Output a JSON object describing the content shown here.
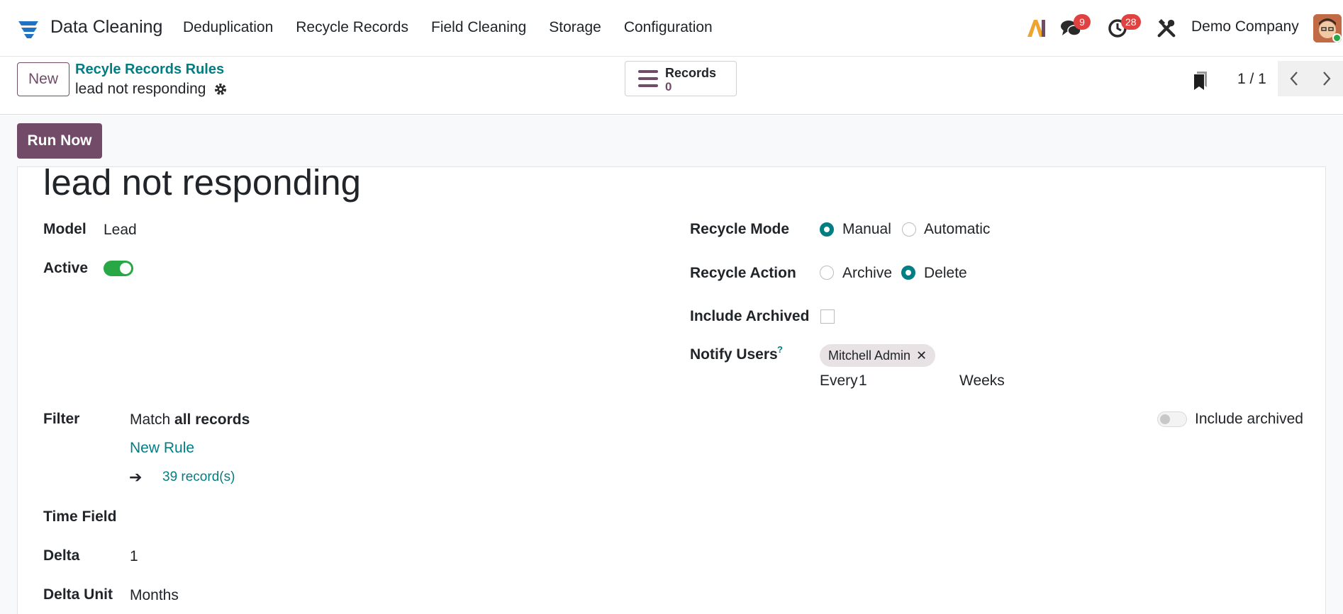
{
  "navbar": {
    "app_name": "Data Cleaning",
    "menu": [
      "Deduplication",
      "Recycle Records",
      "Field Cleaning",
      "Storage",
      "Configuration"
    ],
    "messages_count": "9",
    "activities_count": "28",
    "company": "Demo Company",
    "icons": [
      "app-logo-icon",
      "ai-icon",
      "chat-icon",
      "clock-icon",
      "tools-icon",
      "avatar"
    ]
  },
  "control": {
    "new_label": "New",
    "breadcrumb": "Recyle Records Rules",
    "record_name": "lead not responding",
    "smart_button": {
      "label": "Records",
      "count": "0"
    },
    "pager": "1 / 1"
  },
  "statusbar": {
    "run_now_label": "Run Now"
  },
  "form": {
    "title": "lead not responding",
    "model_label": "Model",
    "model_value": "Lead",
    "active_label": "Active",
    "active": true,
    "recycle_mode_label": "Recycle Mode",
    "recycle_mode_options": [
      "Manual",
      "Automatic"
    ],
    "recycle_mode_selected": "Manual",
    "recycle_action_label": "Recycle Action",
    "recycle_action_options": [
      "Archive",
      "Delete"
    ],
    "recycle_action_selected": "Delete",
    "include_archived_label": "Include Archived",
    "include_archived": false,
    "notify_users_label": "Notify Users",
    "notify_help": "?",
    "notify_tag": "Mitchell Admin",
    "notify_every_label": "Every",
    "notify_every_value": "1",
    "notify_unit": "Weeks",
    "filter_label": "Filter",
    "filter_prefix": "Match",
    "filter_strong": "all records",
    "new_rule": "New Rule",
    "records_arrow": "➔",
    "records_count": "39 record(s)",
    "filter_include_archived": "Include archived",
    "time_field_label": "Time Field",
    "delta_label": "Delta",
    "delta_value": "1",
    "delta_unit_label": "Delta Unit",
    "delta_unit_value": "Months"
  },
  "colors": {
    "brand": "#714b67",
    "accent": "#017e84",
    "badge": "#e04141",
    "toggle_on": "#28a745"
  }
}
